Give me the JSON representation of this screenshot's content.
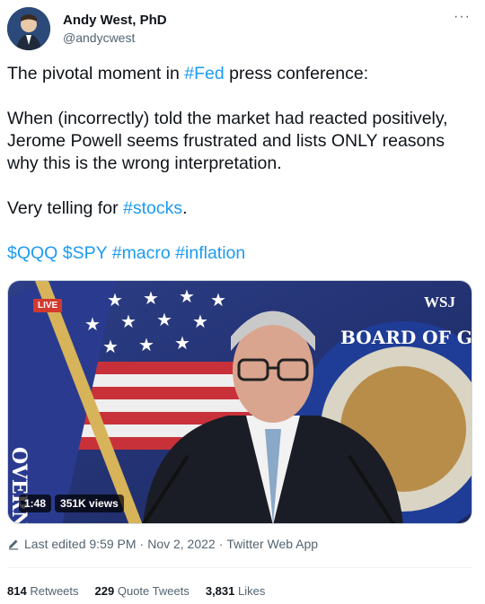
{
  "author": {
    "name": "Andy West, PhD",
    "handle": "@andycwest"
  },
  "tweet": {
    "line1_pre": "The pivotal moment in ",
    "line1_tag": "#Fed",
    "line1_post": " press conference:",
    "para2": "When (incorrectly) told the market had reacted positively, Jerome Powell seems frustrated and lists ONLY reasons why this is the wrong interpretation.",
    "line3_pre": "Very telling for ",
    "line3_tag": "#stocks",
    "line3_post": ".",
    "tags": [
      "$QQQ",
      "$SPY",
      "#macro",
      "#inflation"
    ]
  },
  "media": {
    "live_label": "LIVE",
    "brand": "WSJ",
    "seal_text": "BOARD OF GOVERNORS",
    "seal_left_text": "OVERNO",
    "duration": "1:48",
    "views": "351K views"
  },
  "meta": {
    "edited_label": "Last edited",
    "time": "9:59 PM",
    "dot": "·",
    "date": "Nov 2, 2022",
    "app": "Twitter Web App"
  },
  "stats": {
    "retweets_count": "814",
    "retweets_label": "Retweets",
    "quotes_count": "229",
    "quotes_label": "Quote Tweets",
    "likes_count": "3,831",
    "likes_label": "Likes"
  },
  "colors": {
    "link": "#1d9bf0",
    "text": "#0f1419",
    "muted": "#536471"
  }
}
